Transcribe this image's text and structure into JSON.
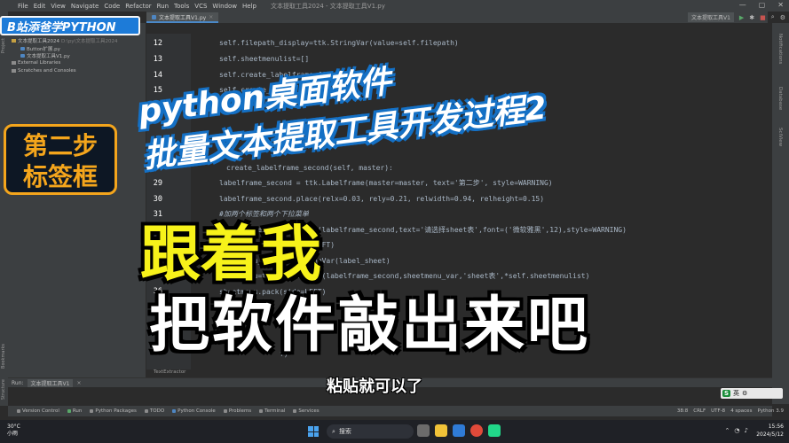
{
  "menubar": {
    "items": [
      "File",
      "Edit",
      "View",
      "Navigate",
      "Code",
      "Refactor",
      "Run",
      "Tools",
      "VCS",
      "Window",
      "Help"
    ],
    "window_title": "文本提取工具2024 - 文本提取工具V1.py",
    "controls": [
      "—",
      "▢",
      "✕"
    ]
  },
  "brand": {
    "text": "B站添爸学PYTHON"
  },
  "project": {
    "rows": [
      {
        "label": "文本提取工具2024",
        "path": "D:\\py\\文本提取工具2024",
        "icon": "folder-icon"
      },
      {
        "label": "Button扩展.py",
        "path": "",
        "icon": "python-file-icon"
      },
      {
        "label": "文本提取工具V1.py",
        "path": "",
        "icon": "python-file-icon"
      },
      {
        "label": "External Libraries",
        "path": "",
        "icon": "library-icon"
      },
      {
        "label": "Scratches and Consoles",
        "path": "",
        "icon": "scratch-icon"
      }
    ],
    "side_labels": [
      "Project",
      "Bookmarks",
      "Structure"
    ]
  },
  "step_label": {
    "line1": "第二步",
    "line2": "标签框"
  },
  "editor": {
    "tab_label": "文本提取工具V1.py",
    "run_config": "文本提取工具V1",
    "breadcrumb": "TextExtractor",
    "line_numbers": [
      "12",
      "13",
      "14",
      "15",
      "29",
      "30",
      "31",
      "36"
    ],
    "code": {
      "l12": "self.filepath_display=ttk.StringVar(value=self.filepath)",
      "l13": "self.sheetmenulist=[]",
      "l14": "self.create_labelframe_first(master)",
      "l15": "self.create_la",
      "ghost1": "...)",
      "l28": "create_labelframe_second(self, master):",
      "l29": "labelframe_second = ttk.Labelframe(master=master, text='第二步', style=WARNING)",
      "l30": "labelframe_second.place(relx=0.03, rely=0.21, relwidth=0.94, relheight=0.15)",
      "l31": "#加两个标签和两个下拉菜单",
      "l32": "label_sheet = ttk.Label(labelframe_second,text='请选择sheet表',font=('微软雅黑',12),style=WARNING)",
      "l33": "label_sheet.pack(side=LEFT)",
      "l34": "sheetmenu_var=ttk.StringVar(label_sheet)",
      "l35": "sheetmenu=ttk.OptionMenu(labelframe_second,sheetmenu_var,'sheet表',*self.sheetmenulist)",
      "l36": "sheetmenu.pack(side=LEFT)",
      "l_end": "f)"
    },
    "right_labels": [
      "Notifications",
      "Database",
      "SciView"
    ]
  },
  "run_panel": {
    "label": "Run:",
    "tab": "文本提取工具V1"
  },
  "bottom_tools": [
    "Version Control",
    "Run",
    "Python Packages",
    "TODO",
    "Python Console",
    "Problems",
    "Terminal",
    "Services"
  ],
  "status": {
    "position": "38:8",
    "line_sep": "CRLF",
    "encoding": "UTF-8",
    "indent": "4 spaces",
    "interpreter": "Python 3.9"
  },
  "taskbar": {
    "weather_temp": "30°C",
    "weather_desc": "小雨",
    "search_placeholder": "搜索",
    "time": "15:56",
    "date": "2024/5/12"
  },
  "overlay": {
    "title1": "python桌面软件",
    "title2": "批量文本提取工具开发过程2",
    "follow": "跟着我",
    "type_out": "把软件敲出来吧",
    "subtitle": "粘贴就可以了"
  },
  "ime": {
    "logo": "S",
    "lang": "英"
  },
  "colors": {
    "brand_blue": "#1d7bd8",
    "step_orange": "#f4a51c",
    "follow_yellow": "#f7f21a",
    "title_stroke": "#1470c5"
  }
}
